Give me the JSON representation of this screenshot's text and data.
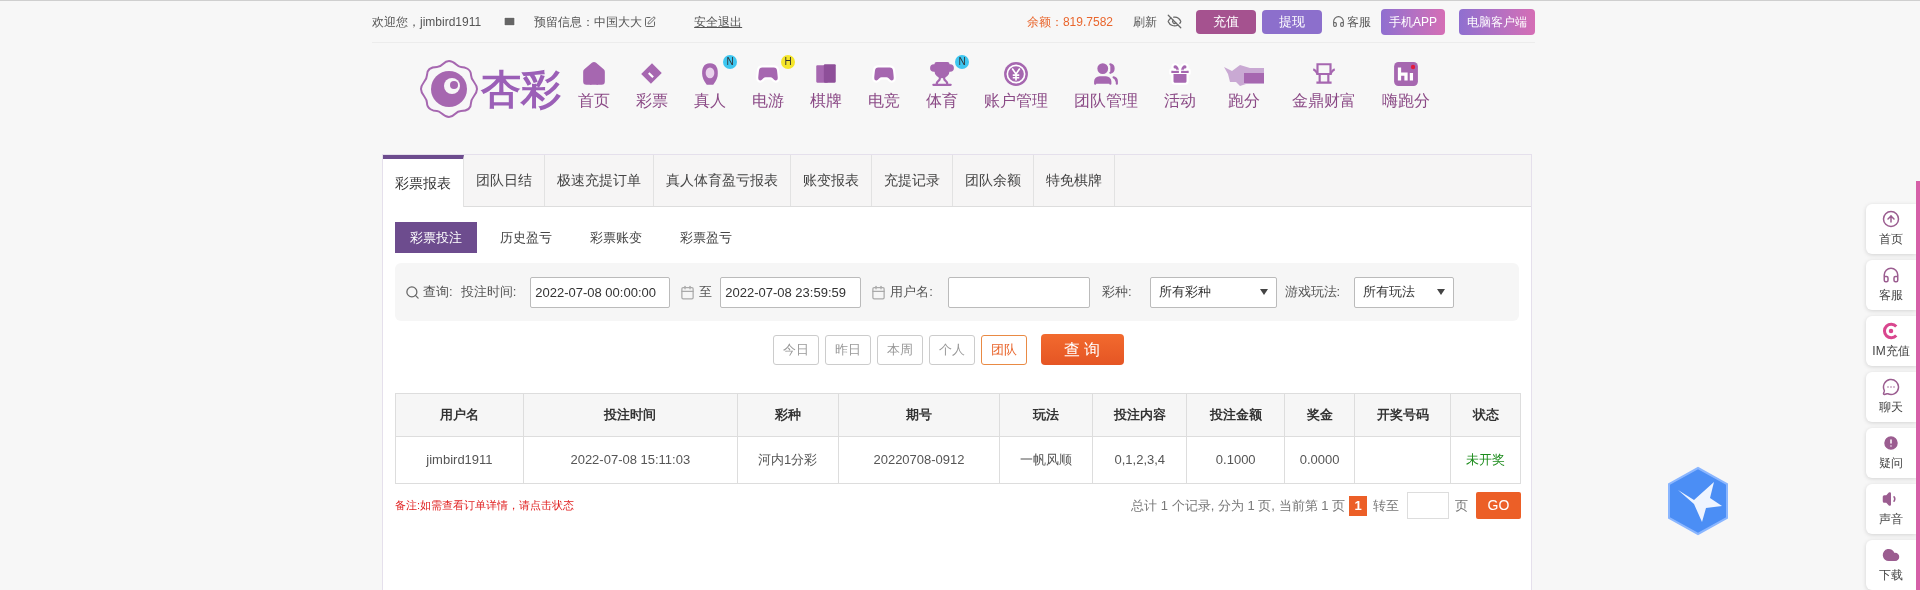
{
  "top_bar": {
    "welcome": "欢迎您，jimbird1911",
    "reserved_info": "预留信息：中国大大",
    "logout": "安全退出",
    "balance": "余额：819.7582",
    "refresh": "刷新",
    "service": "客服",
    "buttons": [
      {
        "label": "充值",
        "kind": "recharge"
      },
      {
        "label": "提现",
        "kind": "withdraw"
      },
      {
        "label": "手机APP",
        "kind": "gradient"
      },
      {
        "label": "电脑客户端",
        "kind": "gradient"
      }
    ]
  },
  "nav": {
    "logo_text": "杏彩",
    "items": [
      {
        "label": "首页"
      },
      {
        "label": "彩票"
      },
      {
        "label": "真人",
        "badge": "N",
        "color": "#3ec6f0"
      },
      {
        "label": "电游",
        "badge": "H",
        "color": "#f5e62a"
      },
      {
        "label": "棋牌"
      },
      {
        "label": "电竞"
      },
      {
        "label": "体育",
        "badge": "N",
        "color": "#3ec6f0"
      },
      {
        "label": "账户管理"
      },
      {
        "label": "团队管理"
      },
      {
        "label": "活动"
      },
      {
        "label": "跑分"
      },
      {
        "label": "金鼎财富"
      },
      {
        "label": "嗨跑分"
      }
    ]
  },
  "report_tabs": [
    {
      "label": "彩票报表",
      "selected": true
    },
    {
      "label": "团队日结",
      "selected": false
    },
    {
      "label": "极速充提订单",
      "selected": false
    },
    {
      "label": "真人体育盈亏报表",
      "selected": false
    },
    {
      "label": "账变报表",
      "selected": false
    },
    {
      "label": "充提记录",
      "selected": false
    },
    {
      "label": "团队余额",
      "selected": false
    },
    {
      "label": "特免棋牌",
      "selected": false
    }
  ],
  "sub_tabs": [
    {
      "label": "彩票投注",
      "selected": true
    },
    {
      "label": "历史盈亏",
      "selected": false
    },
    {
      "label": "彩票账变",
      "selected": false
    },
    {
      "label": "彩票盈亏",
      "selected": false
    }
  ],
  "filter": {
    "query_label": "查询:",
    "time_label": "投注时间:",
    "start": "2022-07-08 00:00:00",
    "to": "至",
    "end": "2022-07-08 23:59:59",
    "username_label": "用户名:",
    "lottery_label": "彩种:",
    "lottery_value": "所有彩种",
    "play_label": "游戏玩法:",
    "play_value": "所有玩法"
  },
  "quick_buttons": [
    {
      "label": "今日",
      "selected": false
    },
    {
      "label": "昨日",
      "selected": false
    },
    {
      "label": "本周",
      "selected": false
    },
    {
      "label": "个人",
      "selected": false
    },
    {
      "label": "团队",
      "selected": true
    }
  ],
  "search_button": "查 询",
  "table": {
    "columns": [
      "用户名",
      "投注时间",
      "彩种",
      "期号",
      "玩法",
      "投注内容",
      "投注金额",
      "奖金",
      "开奖号码",
      "状态"
    ],
    "rows": [
      {
        "cells": [
          "jimbird1911",
          "2022-07-08 15:11:03",
          "河内1分彩",
          "20220708-0912",
          "一帆风顺",
          "0,1,2,3,4",
          "0.1000",
          "0.0000",
          ""
        ],
        "status": "未开奖"
      }
    ]
  },
  "note": "备注:如需查看订单详情，请点击状态",
  "pagination": {
    "summary": "总计 1 个记录, 分为 1 页, 当前第 1 页",
    "current_page": "1",
    "goto_label": "转至",
    "page_unit": "页",
    "go": "GO"
  },
  "side_menu": [
    {
      "label": "首页"
    },
    {
      "label": "客服"
    },
    {
      "label": "IM充值"
    },
    {
      "label": "聊天"
    },
    {
      "label": "疑问"
    },
    {
      "label": "声音"
    },
    {
      "label": "下载"
    }
  ]
}
